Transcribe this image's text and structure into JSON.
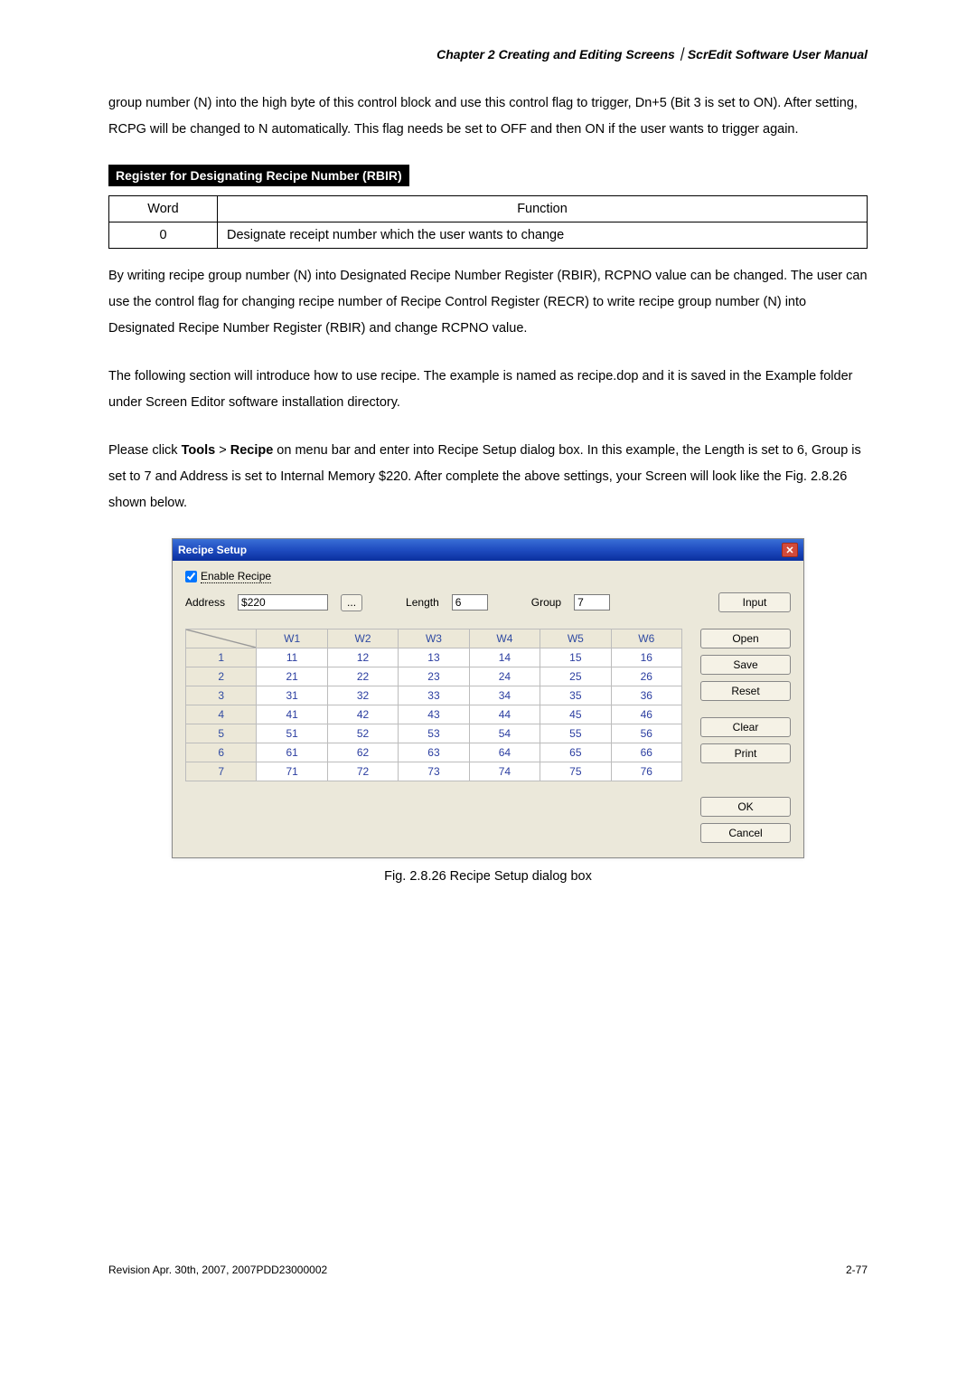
{
  "header": "Chapter 2  Creating and Editing Screens｜ScrEdit Software User Manual",
  "para1": "group number (N) into the high byte of this control block and use this control flag to trigger, Dn+5 (Bit 3 is set to ON). After setting, RCPG will be changed to N automatically. This flag needs be set to OFF and then ON if the user wants to trigger again.",
  "section_title": "Register for Designating Recipe Number (RBIR)",
  "word_func": {
    "h1": "Word",
    "h2": "Function",
    "r1c1": "0",
    "r1c2": "Designate receipt number which the user wants to change"
  },
  "para2": "By writing recipe group number (N) into Designated Recipe Number Register (RBIR), RCPNO value can be changed. The user can use the control flag for changing recipe number of Recipe Control Register (RECR) to write recipe group number (N) into Designated Recipe Number Register (RBIR) and change RCPNO value.",
  "para3": "The following section will introduce how to use recipe. The example is named as recipe.dop and it is saved in the Example folder under Screen Editor software installation directory.",
  "para4_pre": "Please click ",
  "para4_bold1": "Tools",
  "para4_mid1": " > ",
  "para4_bold2": "Recipe",
  "para4_post": " on menu bar and enter into Recipe Setup dialog box. In this example, the Length is set to 6, Group is set to 7 and Address is set to Internal Memory $220. After complete the above settings, your Screen will look like the Fig. 2.8.26 shown below.",
  "dialog": {
    "title": "Recipe Setup",
    "enable_label": "Enable Recipe",
    "address_label": "Address",
    "address_value": "$220",
    "ellipsis": "...",
    "length_label": "Length",
    "length_value": "6",
    "group_label": "Group",
    "group_value": "7",
    "btn_input": "Input",
    "btn_open": "Open",
    "btn_save": "Save",
    "btn_reset": "Reset",
    "btn_clear": "Clear",
    "btn_print": "Print",
    "btn_ok": "OK",
    "btn_cancel": "Cancel",
    "cols": [
      "W1",
      "W2",
      "W3",
      "W4",
      "W5",
      "W6"
    ],
    "rows": [
      {
        "n": "1",
        "v": [
          "11",
          "12",
          "13",
          "14",
          "15",
          "16"
        ]
      },
      {
        "n": "2",
        "v": [
          "21",
          "22",
          "23",
          "24",
          "25",
          "26"
        ]
      },
      {
        "n": "3",
        "v": [
          "31",
          "32",
          "33",
          "34",
          "35",
          "36"
        ]
      },
      {
        "n": "4",
        "v": [
          "41",
          "42",
          "43",
          "44",
          "45",
          "46"
        ]
      },
      {
        "n": "5",
        "v": [
          "51",
          "52",
          "53",
          "54",
          "55",
          "56"
        ]
      },
      {
        "n": "6",
        "v": [
          "61",
          "62",
          "63",
          "64",
          "65",
          "66"
        ]
      },
      {
        "n": "7",
        "v": [
          "71",
          "72",
          "73",
          "74",
          "75",
          "76"
        ]
      }
    ]
  },
  "fig_caption": "Fig. 2.8.26 Recipe Setup dialog box",
  "footer_left": "Revision Apr. 30th, 2007, 2007PDD23000002",
  "footer_right": "2-77"
}
